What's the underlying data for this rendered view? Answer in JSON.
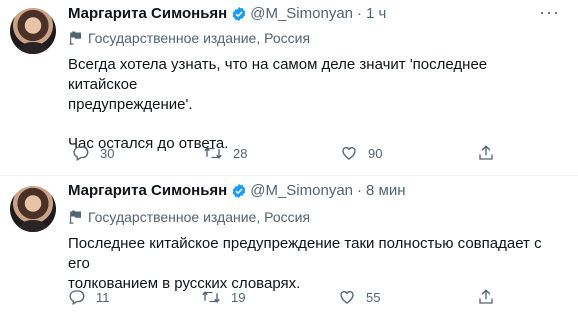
{
  "tweets": [
    {
      "author_name": "Маргарита Симоньян",
      "handle": "@M_Simonyan",
      "separator": "·",
      "time": "1 ч",
      "label": "Государственное издание, Россия",
      "text_line1": "Всегда хотела узнать, что на самом деле значит 'последнее китайское",
      "text_line2": "предупреждение'.",
      "text_line3": "Час остался до ответа.",
      "replies": "30",
      "retweets": "28",
      "likes": "90"
    },
    {
      "author_name": "Маргарита Симоньян",
      "handle": "@M_Simonyan",
      "separator": "·",
      "time": "8 мин",
      "label": "Государственное издание, Россия",
      "text_line1": "Последнее китайское предупреждение таки полностью совпадает с его",
      "text_line2": "толкованием в русских словарях.",
      "replies": "11",
      "retweets": "19",
      "likes": "55"
    }
  ],
  "colors": {
    "text": "#0f1419",
    "muted": "#536471",
    "verified": "#1d9bf0",
    "divider": "#eff3f4"
  },
  "icons": [
    "verified-badge-icon",
    "state-media-icon",
    "reply-icon",
    "retweet-icon",
    "like-icon",
    "share-icon",
    "more-icon"
  ]
}
